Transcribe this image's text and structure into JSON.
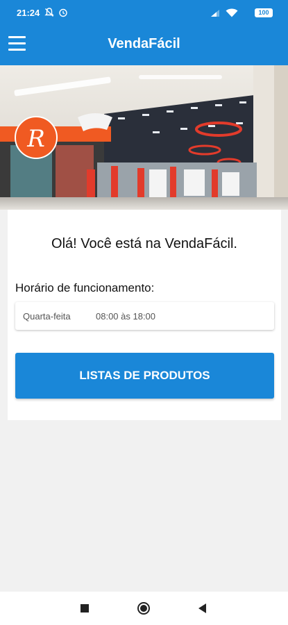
{
  "status_bar": {
    "time": "21:24",
    "battery": "100"
  },
  "app_bar": {
    "title": "VendaFácil"
  },
  "hero": {
    "brand_letter": "R"
  },
  "main": {
    "greeting": "Olá! Você está na VendaFácil.",
    "hours_title": "Horário de funcionamento:",
    "hours": [
      {
        "day": "Quarta-feita",
        "time": "08:00 às 18:00"
      }
    ],
    "products_button": "LISTAS DE PRODUTOS"
  },
  "colors": {
    "primary": "#1a87d8",
    "brand_orange": "#f05a22",
    "background": "#f1f1f1"
  },
  "icons": [
    "menu-icon",
    "recents-icon",
    "home-icon",
    "back-icon"
  ]
}
